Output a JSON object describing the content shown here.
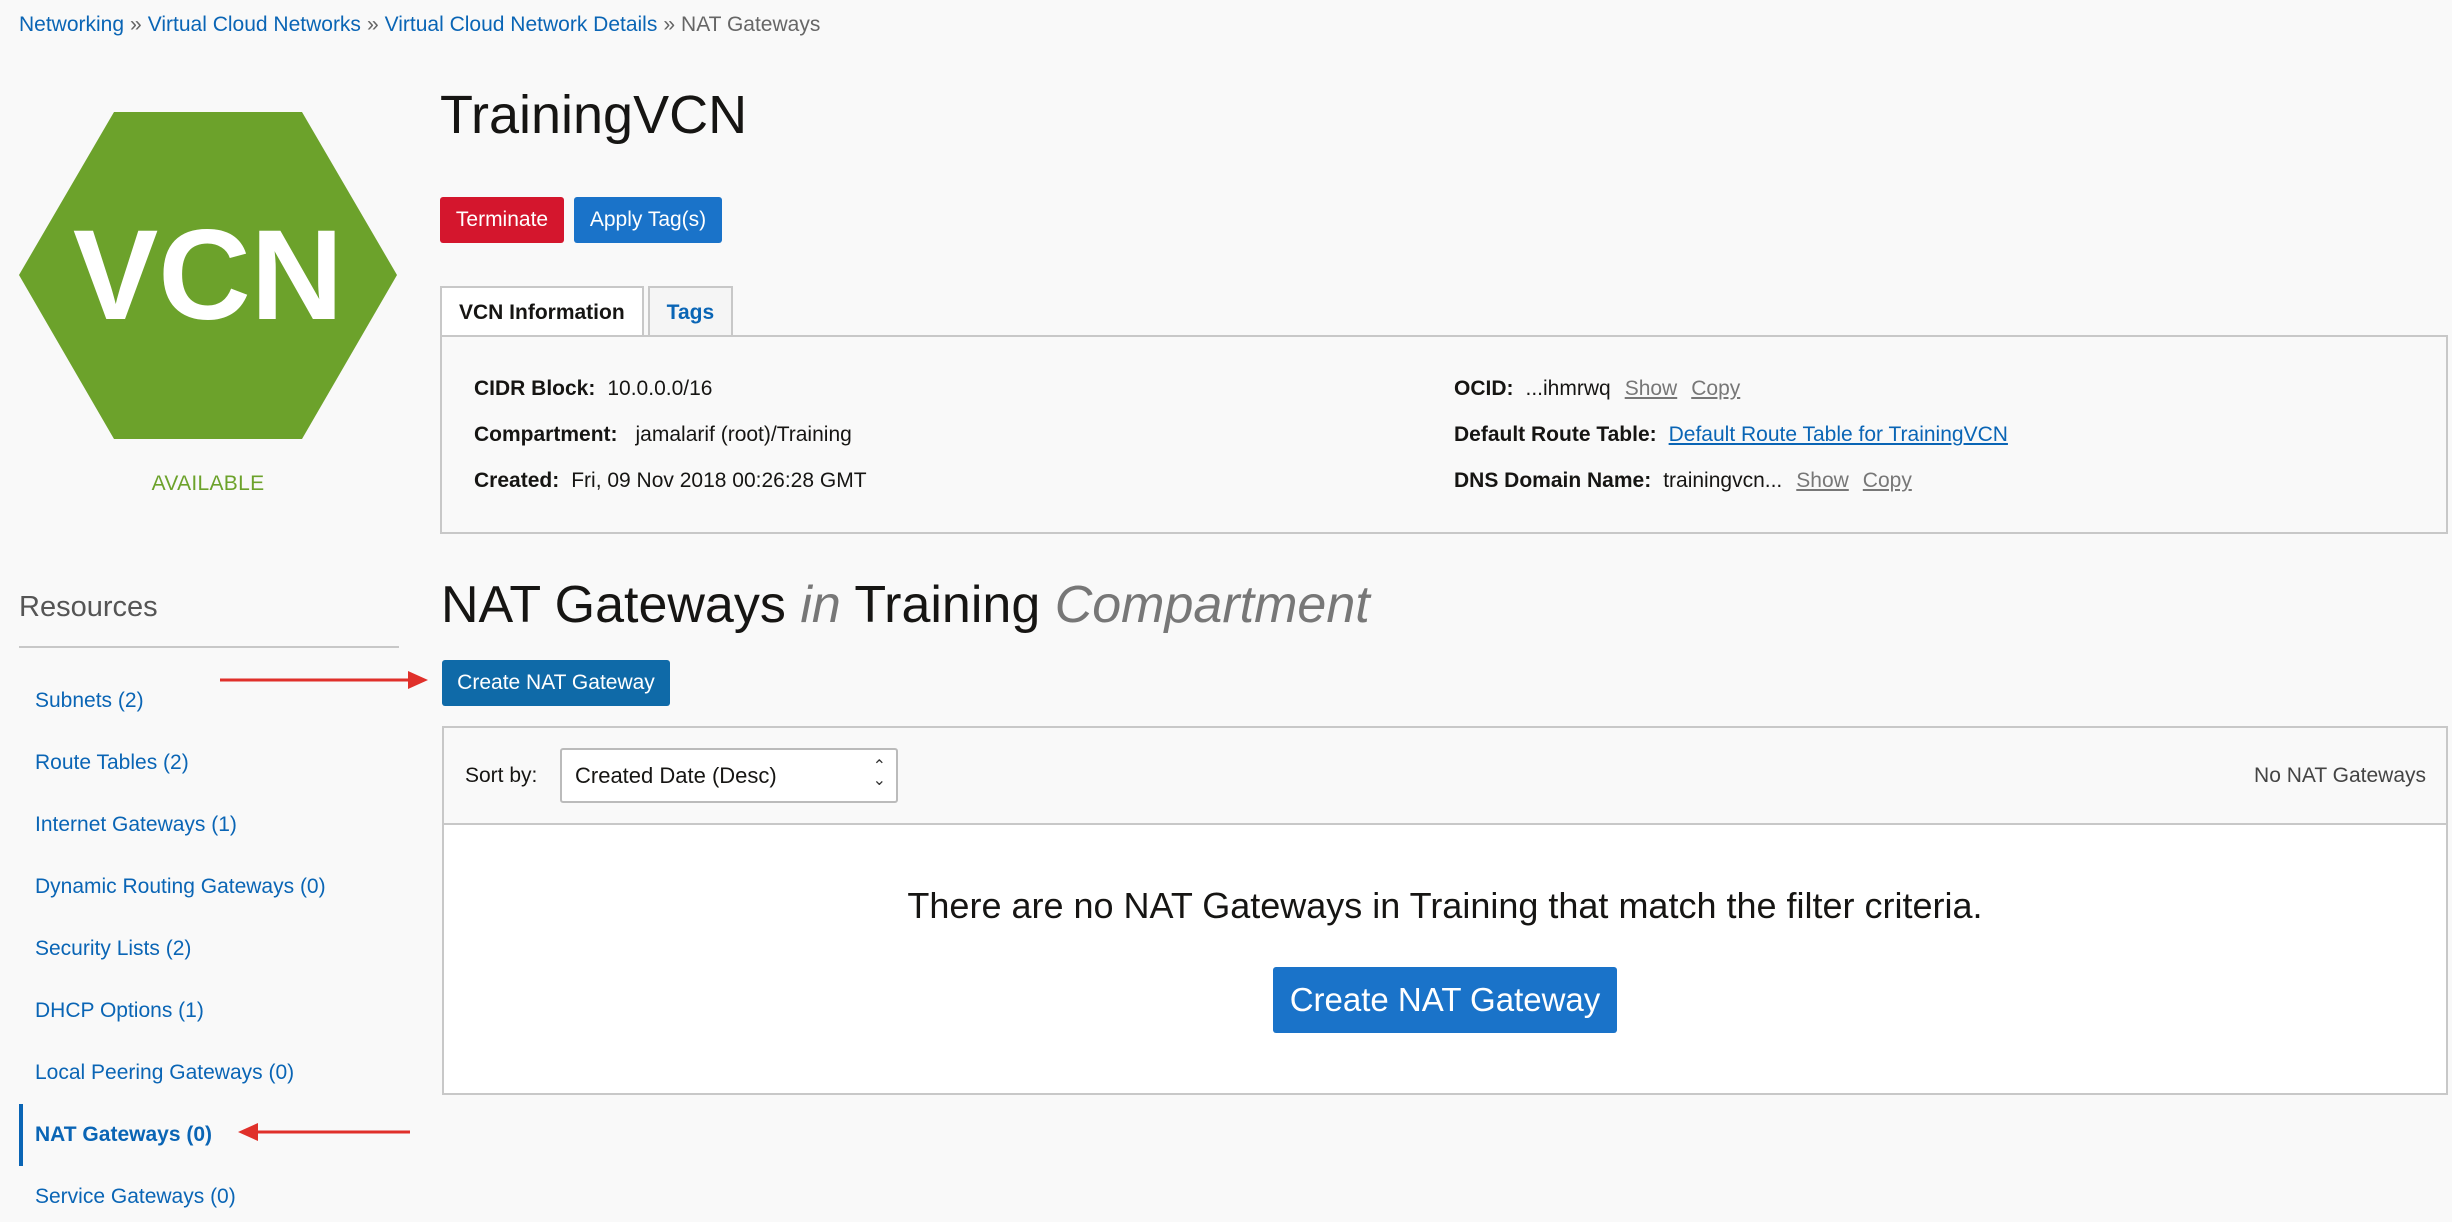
{
  "breadcrumb": {
    "items": [
      "Networking",
      "Virtual Cloud Networks",
      "Virtual Cloud Network Details"
    ],
    "separator": "»",
    "current": "NAT Gateways"
  },
  "vcn": {
    "icon_text": "VCN",
    "status": "AVAILABLE",
    "title": "TrainingVCN",
    "colors": {
      "hex": "#6ca22b",
      "status": "#6ca22b"
    }
  },
  "actions": {
    "terminate": "Terminate",
    "apply_tags": "Apply Tag(s)"
  },
  "tabs": [
    {
      "label": "VCN Information"
    },
    {
      "label": "Tags"
    }
  ],
  "info": {
    "cidr_label": "CIDR Block:",
    "cidr_value": "10.0.0.0/16",
    "compartment_label": "Compartment:",
    "compartment_value": "jamalarif (root)/Training",
    "created_label": "Created:",
    "created_value": "Fri, 09 Nov 2018 00:26:28 GMT",
    "ocid_label": "OCID:",
    "ocid_value": "...ihmrwq",
    "route_label": "Default Route Table:",
    "route_value": "Default Route Table for TrainingVCN",
    "dns_label": "DNS Domain Name:",
    "dns_value": "trainingvcn...",
    "show": "Show",
    "copy": "Copy"
  },
  "resources": {
    "title": "Resources",
    "items": [
      {
        "label": "Subnets (2)"
      },
      {
        "label": "Route Tables (2)"
      },
      {
        "label": "Internet Gateways (1)"
      },
      {
        "label": "Dynamic Routing Gateways (0)"
      },
      {
        "label": "Security Lists (2)"
      },
      {
        "label": "DHCP Options (1)"
      },
      {
        "label": "Local Peering Gateways (0)"
      },
      {
        "label": "NAT Gateways (0)"
      },
      {
        "label": "Service Gateways (0)"
      }
    ]
  },
  "section": {
    "title_a": "NAT Gateways",
    "title_in": "in",
    "title_b": "Training",
    "title_c": "Compartment",
    "create_button": "Create NAT Gateway"
  },
  "list": {
    "sort_label": "Sort by:",
    "sort_value": "Created Date (Desc)",
    "count_text": "No NAT Gateways",
    "empty_message": "There are no NAT Gateways in Training that match the filter criteria.",
    "create_button": "Create NAT Gateway"
  }
}
